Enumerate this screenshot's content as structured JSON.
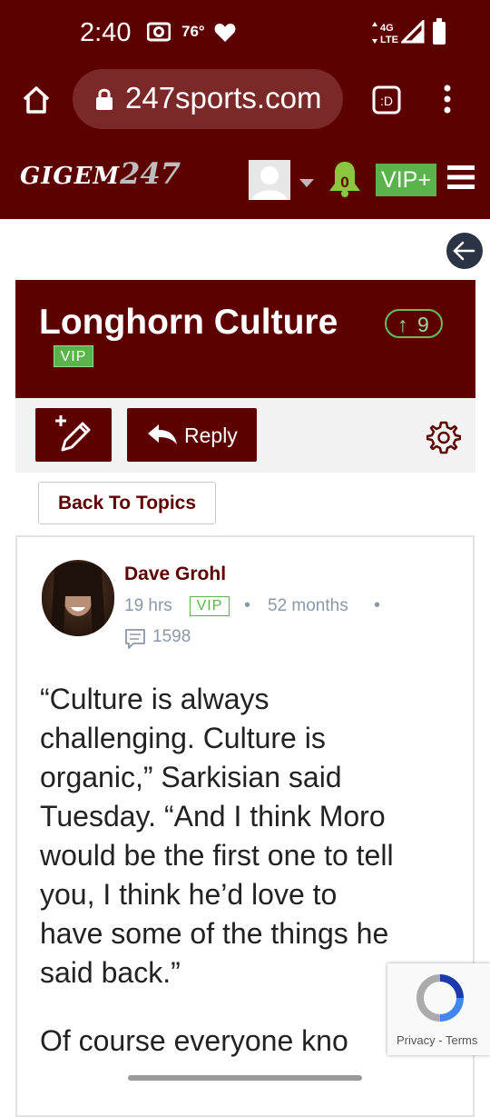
{
  "status_bar": {
    "time": "2:40",
    "temperature": "76°",
    "network": "4G LTE"
  },
  "browser": {
    "url": "247sports.com",
    "tab_label": ":D"
  },
  "site_header": {
    "logo_text": "GIGEM",
    "logo_suffix": "247",
    "notification_count": "0",
    "vip_label": "VIP+"
  },
  "thread": {
    "title": "Longhorn Culture",
    "upvotes": "9",
    "vip_tag": "VIP"
  },
  "toolbar": {
    "reply_label": "Reply",
    "back_to_topics": "Back To Topics"
  },
  "post": {
    "author": "Dave Grohl",
    "time_ago": "19 hrs",
    "vip_tag": "VIP",
    "member_since": "52 months",
    "post_count": "1598",
    "body_lines": [
      "“Culture is always",
      "challenging. Culture is",
      "organic,” Sarkisian said",
      "Tuesday. “And I think Moro",
      "would be the first one to tell",
      "you, I think he’d love to",
      "have some of the things he",
      "said back.”"
    ],
    "second_paragraph": "Of course everyone kno"
  },
  "recaptcha": {
    "privacy": "Privacy",
    "separator": "-",
    "terms": "Terms"
  },
  "colors": {
    "brand": "#5c0000",
    "vip_green": "#5ab44b",
    "meta_gray": "#8a98a8"
  }
}
